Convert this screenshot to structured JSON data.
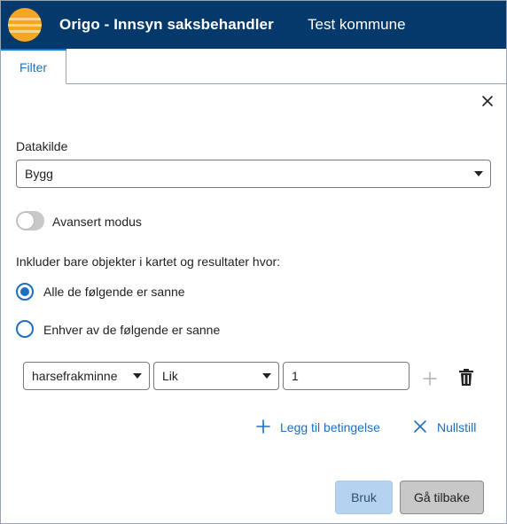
{
  "header": {
    "app_title": "Origo - Innsyn saksbehandler",
    "org_title": "Test kommune",
    "logo_icon": "origo-logo-icon",
    "background": "#05396b"
  },
  "tabs": [
    {
      "label": "Filter",
      "active": true
    }
  ],
  "panel": {
    "close_icon": "close-icon",
    "datasource": {
      "label": "Datakilde",
      "selected": "Bygg"
    },
    "advanced": {
      "label": "Avansert modus",
      "enabled": false
    },
    "include_label": "Inkluder bare objekter i kartet og resultater hvor:",
    "match_options": [
      {
        "label": "Alle de følgende er sanne",
        "checked": true
      },
      {
        "label": "Enhver av de følgende er sanne",
        "checked": false
      }
    ],
    "condition": {
      "field": "harsefrakminne",
      "operator": "Lik",
      "value": "1",
      "add_icon": "plus-icon",
      "delete_icon": "trash-icon"
    },
    "add_condition_label": "Legg til betingelse",
    "reset_label": "Nullstill"
  },
  "footer": {
    "apply_label": "Bruk",
    "back_label": "Gå tilbake"
  },
  "colors": {
    "accent": "#1d6fc0",
    "primary_button": "#b5d3f0",
    "secondary_button": "#c8c8c8"
  }
}
